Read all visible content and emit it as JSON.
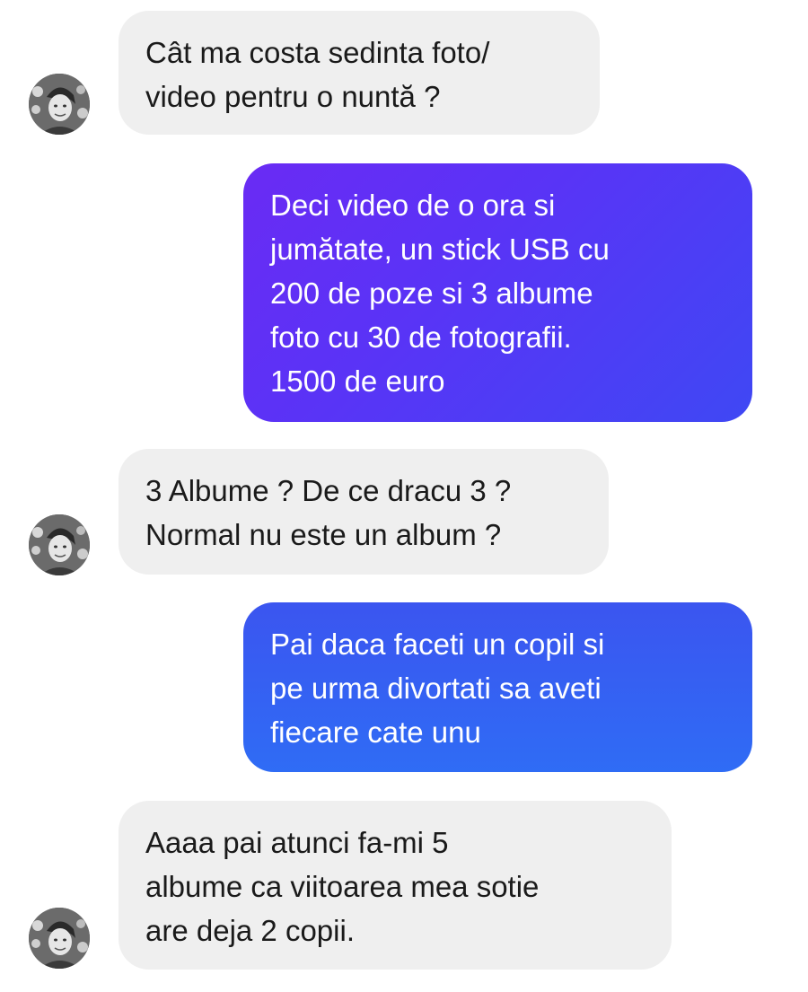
{
  "conversation": {
    "messages": [
      {
        "sender": "contact",
        "lines": [
          "Cât ma costa sedinta foto/",
          "video pentru o nuntă ?"
        ]
      },
      {
        "sender": "me",
        "lines": [
          "Deci video de o ora si",
          "jumătate, un stick USB cu",
          "200 de poze si 3 albume",
          "foto cu 30 de fotografii.",
          "1500 de euro"
        ]
      },
      {
        "sender": "contact",
        "lines": [
          "3 Albume ? De ce dracu 3 ?",
          "Normal nu este un album ?"
        ]
      },
      {
        "sender": "me",
        "lines": [
          "Pai daca faceti un copil si",
          "pe urma divortati sa aveti",
          "fiecare cate unu"
        ]
      },
      {
        "sender": "contact",
        "lines": [
          "Aaaa pai atunci fa-mi 5",
          "albume ca viitoarea mea sotie",
          "are deja 2 copii."
        ]
      }
    ]
  },
  "avatar": {
    "icon": "user-avatar-icon"
  },
  "colors": {
    "incoming_bubble": "#efefef",
    "incoming_text": "#1a1a1a",
    "outgoing_text": "#ffffff",
    "outgoing_gradient_purple": "#6a2bf4",
    "outgoing_gradient_blue": "#2f6cf5"
  }
}
